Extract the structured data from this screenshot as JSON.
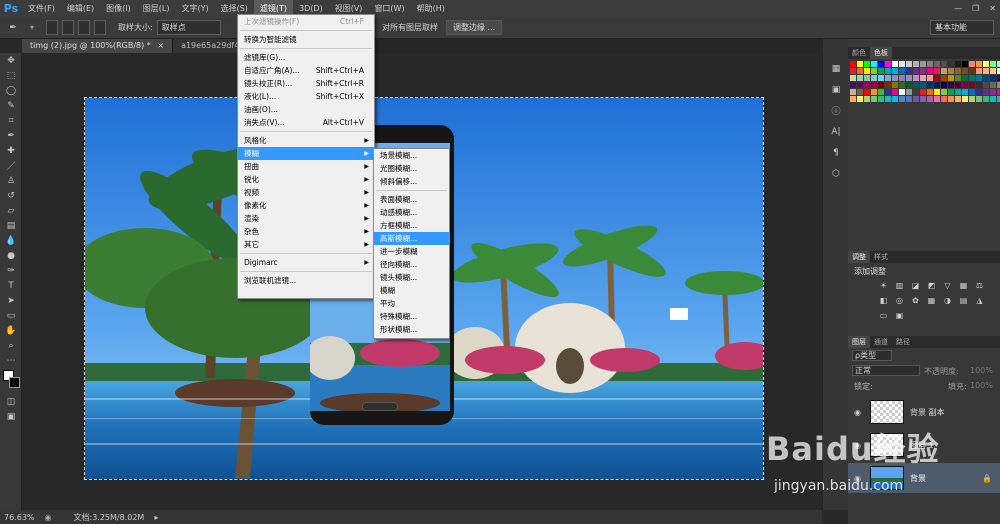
{
  "app": {
    "logo": "Ps"
  },
  "menubar": {
    "items": [
      "文件(F)",
      "编辑(E)",
      "图像(I)",
      "图层(L)",
      "文字(Y)",
      "选择(S)",
      "滤镜(T)",
      "3D(D)",
      "视图(V)",
      "窗口(W)",
      "帮助(H)"
    ],
    "active_index": 6,
    "window_controls": [
      "—",
      "❐",
      "✕"
    ]
  },
  "options_bar": {
    "sample_size_label": "取样大小:",
    "sample_size_value": "取样点",
    "sample_all_layers": "对所有图层取样",
    "adjust_edge_button": "调整边缘 ...",
    "workspace_select": "基本功能"
  },
  "tabs": [
    {
      "label": "timg (2).jpg @ 100%(RGB/8) *",
      "close": "×"
    },
    {
      "label": "a19e65a29df4e61c994",
      "close": ""
    }
  ],
  "filter_menu": {
    "items": [
      {
        "label": "上次滤镜操作(F)",
        "shortcut": "Ctrl+F",
        "disabled": true
      },
      {
        "sep": true
      },
      {
        "label": "转换为智能滤镜"
      },
      {
        "sep": true
      },
      {
        "label": "滤镜库(G)..."
      },
      {
        "label": "自适应广角(A)...",
        "shortcut": "Shift+Ctrl+A"
      },
      {
        "label": "镜头校正(R)...",
        "shortcut": "Shift+Ctrl+R"
      },
      {
        "label": "液化(L)...",
        "shortcut": "Shift+Ctrl+X"
      },
      {
        "label": "油画(O)..."
      },
      {
        "label": "消失点(V)...",
        "shortcut": "Alt+Ctrl+V"
      },
      {
        "sep": true
      },
      {
        "label": "风格化",
        "submenu": true
      },
      {
        "label": "模糊",
        "submenu": true,
        "highlight": true
      },
      {
        "label": "扭曲",
        "submenu": true
      },
      {
        "label": "锐化",
        "submenu": true
      },
      {
        "label": "视频",
        "submenu": true
      },
      {
        "label": "像素化",
        "submenu": true
      },
      {
        "label": "渲染",
        "submenu": true
      },
      {
        "label": "杂色",
        "submenu": true
      },
      {
        "label": "其它",
        "submenu": true
      },
      {
        "sep": true
      },
      {
        "label": "Digimarc",
        "submenu": true
      },
      {
        "sep": true
      },
      {
        "label": "浏览联机滤镜..."
      }
    ]
  },
  "blur_submenu": {
    "items": [
      {
        "label": "场景模糊..."
      },
      {
        "label": "光圈模糊..."
      },
      {
        "label": "倾斜偏移..."
      },
      {
        "sep": true
      },
      {
        "label": "表面模糊..."
      },
      {
        "label": "动感模糊..."
      },
      {
        "label": "方框模糊..."
      },
      {
        "label": "高斯模糊...",
        "highlight": true
      },
      {
        "label": "进一步模糊"
      },
      {
        "label": "径向模糊..."
      },
      {
        "label": "镜头模糊..."
      },
      {
        "label": "模糊"
      },
      {
        "label": "平均"
      },
      {
        "label": "特殊模糊..."
      },
      {
        "label": "形状模糊..."
      }
    ]
  },
  "status": {
    "zoom": "76.63%",
    "doc": "文档:3.25M/8.02M"
  },
  "swatches_panel": {
    "tabs": [
      "颜色",
      "色板"
    ],
    "active": 1
  },
  "adjustments_panel": {
    "tabs": [
      "调整",
      "样式"
    ],
    "title": "添加调整"
  },
  "layers_panel": {
    "tabs": [
      "图层",
      "通道",
      "路径"
    ],
    "kind_filter": "ρ类型",
    "blend_mode": "正常",
    "opacity_label": "不透明度:",
    "opacity_value": "100%",
    "lock_label": "锁定:",
    "fill_label": "填充:",
    "fill_value": "100%",
    "layers": [
      {
        "name": "背景 副本"
      },
      {
        "name": "图层 1"
      },
      {
        "name": "背景",
        "locked": true,
        "selected": true
      }
    ]
  },
  "watermark": {
    "line1": "Baidu经验",
    "line2": "jingyan.baidu.com"
  },
  "colors": {
    "accent": "#3399ff",
    "menu_bg": "#f0f0f0",
    "panel_bg": "#383838"
  }
}
